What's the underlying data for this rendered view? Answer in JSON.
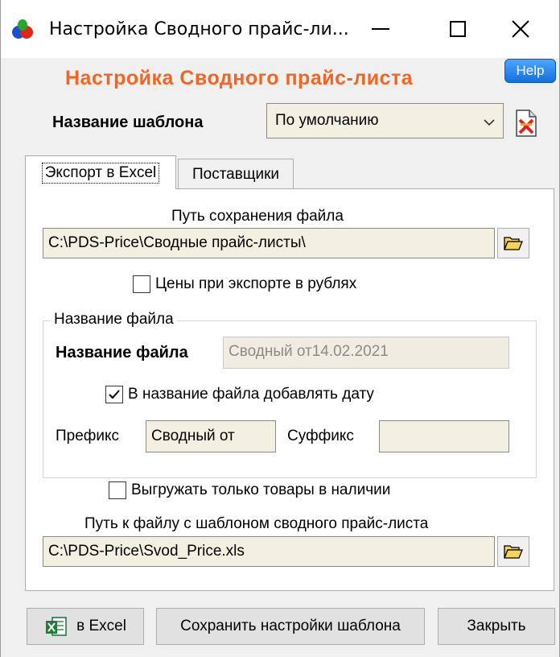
{
  "window": {
    "title": "Настройка Сводного прайс-ли..."
  },
  "header": {
    "title": "Настройка Сводного прайс-листа",
    "help_label": "Help"
  },
  "template": {
    "label": "Название шаблона",
    "selected": "По умолчанию"
  },
  "tabs": [
    {
      "label": "Экспорт в Excel",
      "active": true
    },
    {
      "label": "Поставщики",
      "active": false
    }
  ],
  "export": {
    "save_path_label": "Путь сохранения файла",
    "save_path_value": "C:\\PDS-Price\\Сводные прайс-листы\\",
    "rubles_checkbox": {
      "label": "Цены при экспорте в рублях",
      "checked": false
    },
    "filename_group": {
      "title": "Название файла",
      "filename_label": "Название файла",
      "filename_value": "Сводный от14.02.2021",
      "add_date_checkbox": {
        "label": "В название файла добавлять дату",
        "checked": true
      },
      "prefix_label": "Префикс",
      "prefix_value": "Сводный от",
      "suffix_label": "Суффикс",
      "suffix_value": ""
    },
    "in_stock_checkbox": {
      "label": "Выгружать только товары в наличии",
      "checked": false
    },
    "template_path_label": "Путь к файлу с шаблоном сводного прайс-листа",
    "template_path_value": "C:\\PDS-Price\\Svod_Price.xls"
  },
  "buttons": {
    "excel": "в Excel",
    "save": "Сохранить настройки шаблона",
    "close": "Закрыть"
  },
  "colors": {
    "accent_title": "#f26522",
    "input_bg": "#f4f0e1",
    "help_bg": "#1570e0"
  }
}
